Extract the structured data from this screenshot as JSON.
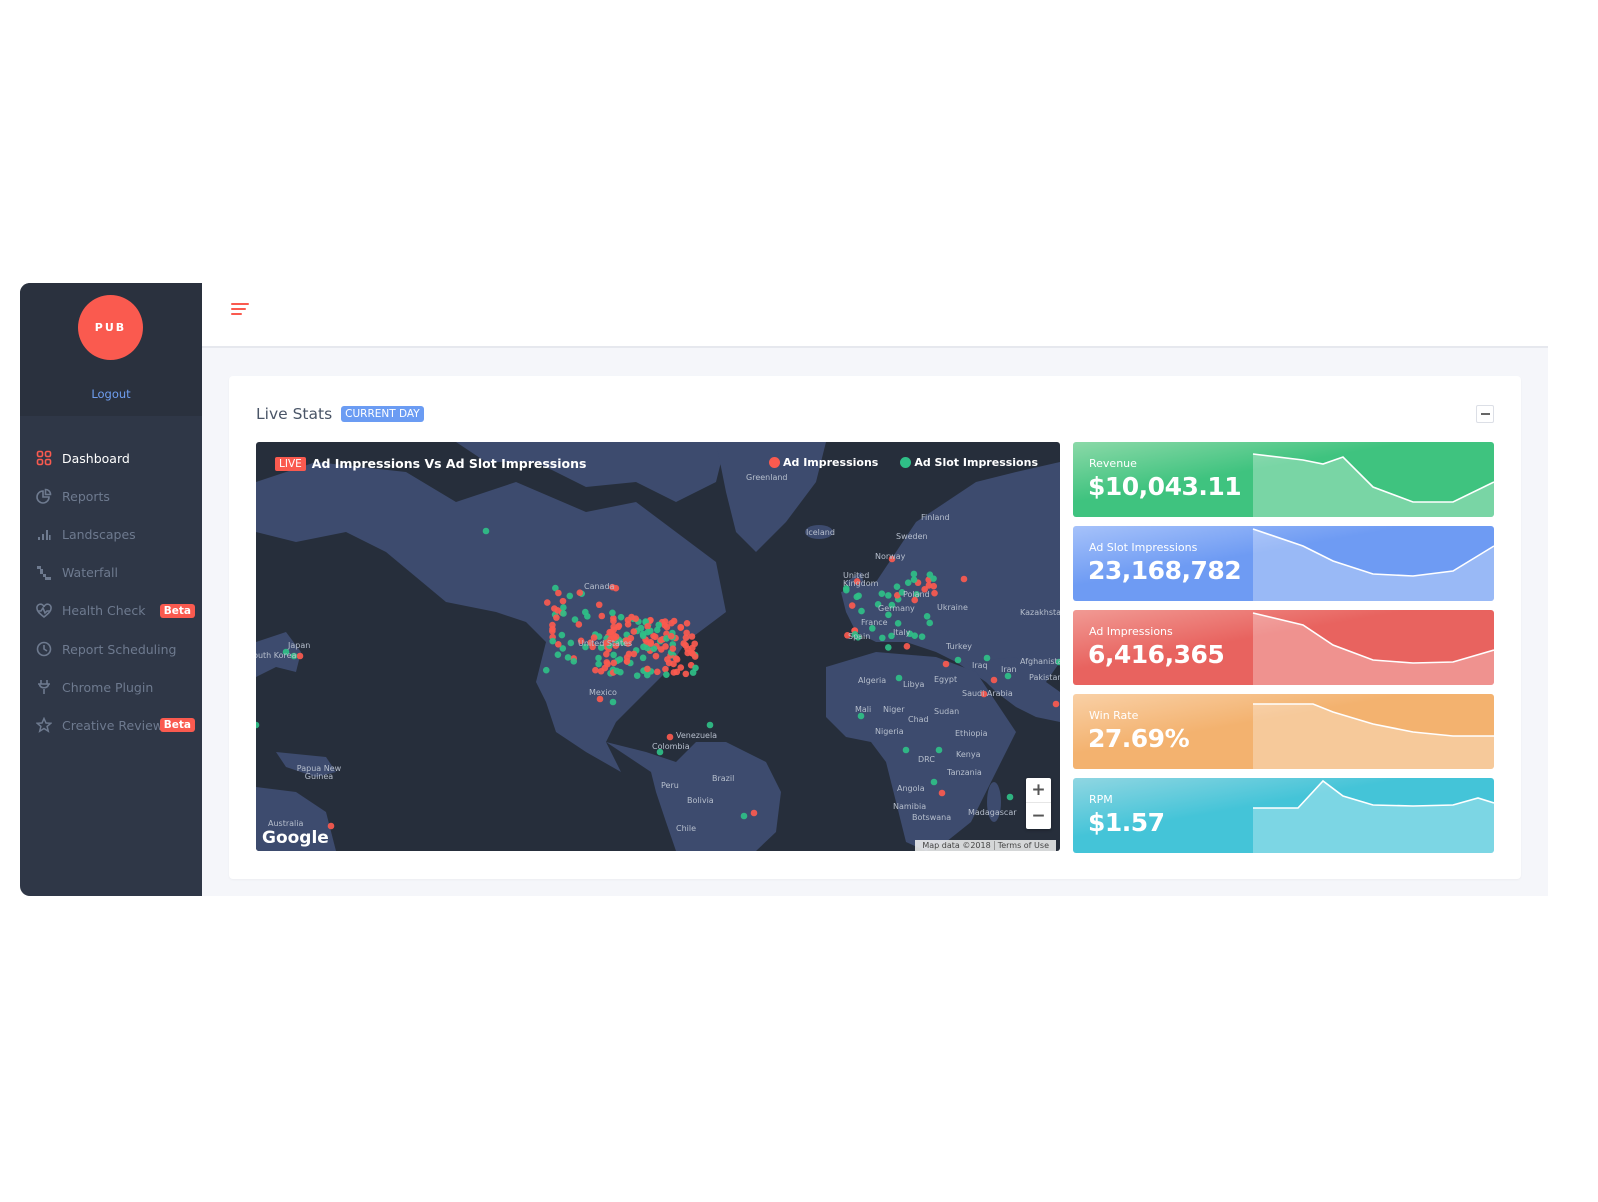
{
  "sidebar": {
    "avatar_text": "PUB",
    "logout_label": "Logout",
    "items": [
      {
        "label": "Dashboard",
        "icon": "grid-icon",
        "active": true
      },
      {
        "label": "Reports",
        "icon": "pie-chart-icon"
      },
      {
        "label": "Landscapes",
        "icon": "bar-chart-icon"
      },
      {
        "label": "Waterfall",
        "icon": "waterfall-icon"
      },
      {
        "label": "Health Check",
        "icon": "heart-pulse-icon",
        "badge": "Beta"
      },
      {
        "label": "Report Scheduling",
        "icon": "clock-icon"
      },
      {
        "label": "Chrome Plugin",
        "icon": "plug-icon"
      },
      {
        "label": "Creative Review",
        "icon": "star-icon",
        "badge": "Beta"
      }
    ]
  },
  "topbar": {
    "menu_icon": "hamburger-icon"
  },
  "live_stats": {
    "title": "Live Stats",
    "period_badge": "CURRENT DAY",
    "collapse_icon": "minus-icon",
    "map": {
      "live_badge": "LIVE",
      "title": "Ad Impressions Vs Ad Slot Impressions",
      "legend": [
        {
          "label": "Ad Impressions",
          "color": "#fa5a4f"
        },
        {
          "label": "Ad Slot Impressions",
          "color": "#2fbf87"
        }
      ],
      "geo_labels": [
        "Greenland",
        "Iceland",
        "Finland",
        "Sweden",
        "Norway",
        "United Kingdom",
        "Poland",
        "Germany",
        "Ukraine",
        "Kazakhstan",
        "France",
        "Spain",
        "Italy",
        "Turkey",
        "Iraq",
        "Iran",
        "Afghanistan",
        "Pakistan",
        "Algeria",
        "Libya",
        "Egypt",
        "Saudi Arabia",
        "Mali",
        "Niger",
        "Chad",
        "Sudan",
        "Nigeria",
        "Ethiopia",
        "DRC",
        "Kenya",
        "Tanzania",
        "Angola",
        "Namibia",
        "Botswana",
        "Madagascar",
        "Canada",
        "United States",
        "Mexico",
        "Venezuela",
        "Colombia",
        "Brazil",
        "Peru",
        "Bolivia",
        "Chile",
        "Japan",
        "South Korea",
        "Papua New Guinea",
        "Australia"
      ],
      "zoom_in": "+",
      "zoom_out": "−",
      "brand": "Google",
      "map_data": "Map data ©2018",
      "terms": "Terms of Use"
    },
    "cards": [
      {
        "label": "Revenue",
        "value": "$10,043.11",
        "colors": [
          "#3fc37f",
          "#8bd9a8"
        ]
      },
      {
        "label": "Ad Slot Impressions",
        "value": "23,168,782",
        "colors": [
          "#6e9bf3",
          "#a6c2fa"
        ]
      },
      {
        "label": "Ad Impressions",
        "value": "6,416,365",
        "colors": [
          "#e8635f",
          "#f19a94"
        ]
      },
      {
        "label": "Win Rate",
        "value": "27.69%",
        "colors": [
          "#f3b26f",
          "#f9d0a6"
        ]
      },
      {
        "label": "RPM",
        "value": "$1.57",
        "colors": [
          "#44c4d8",
          "#90d6e2"
        ]
      }
    ]
  }
}
